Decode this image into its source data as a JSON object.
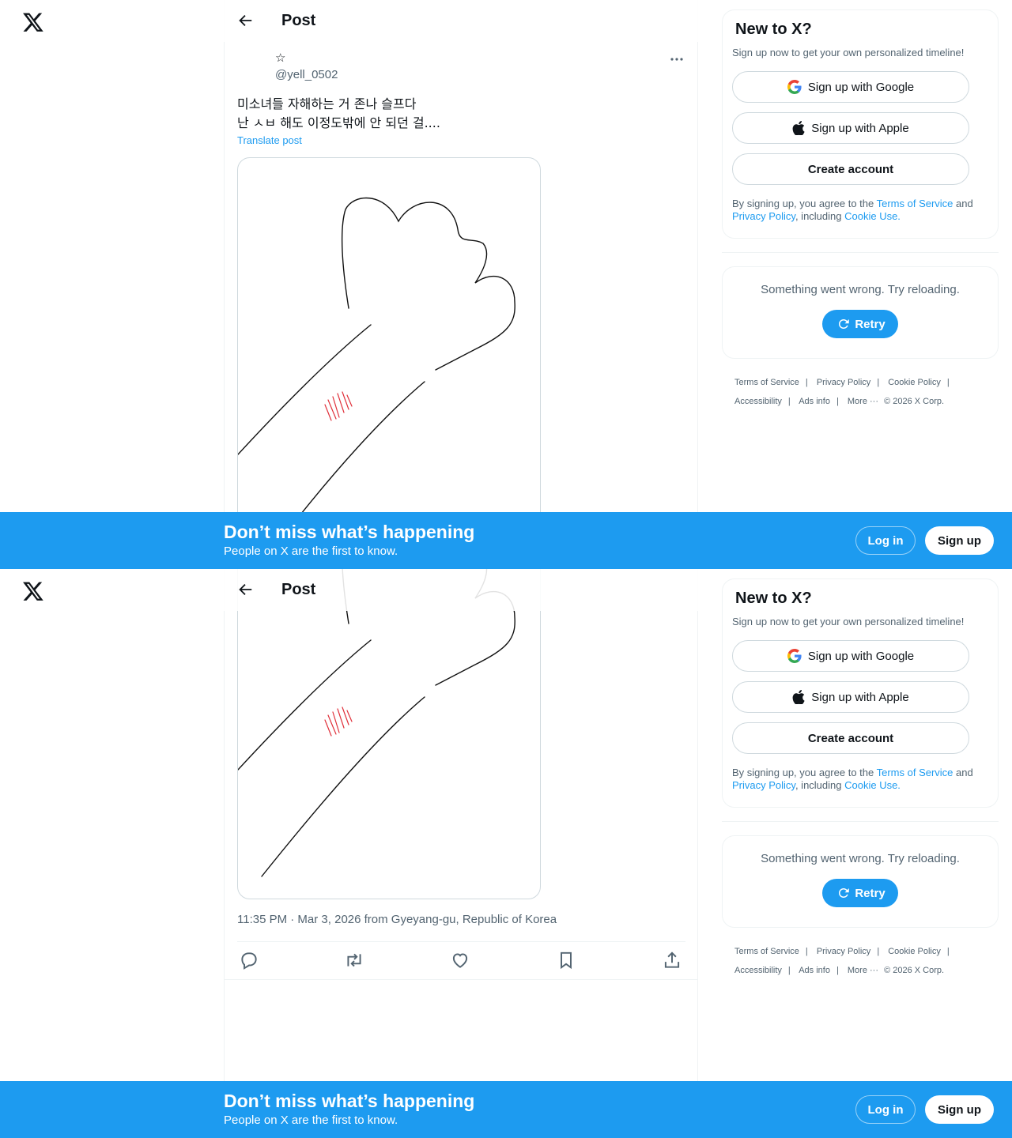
{
  "screens": [
    {
      "header": {
        "title": "Post"
      },
      "post": {
        "author_name": "☆",
        "handle": "@yell_0502",
        "text_line1": "미소녀들 자해하는 거 존나 슬프다",
        "text_line2": "난 ㅅㅂ 해도 이정도밖에 안 되던 걸....",
        "translate_label": "Translate post",
        "timestamp": "11:35 PM · Mar 3, 2026 from Gyeyang-gu, Republic of Korea"
      },
      "sidebar": {
        "heading": "New to X?",
        "subtext": "Sign up now to get your own personalized timeline!",
        "google_label": "Sign up with Google",
        "apple_label": "Sign up with Apple",
        "create_label": "Create account",
        "terms_prefix": "By signing up, you agree to the ",
        "terms_link": "Terms of Service",
        "terms_and": " and",
        "privacy_link": "Privacy Policy",
        "terms_including": ", including ",
        "cookie_link": "Cookie Use.",
        "error_msg": "Something went wrong. Try reloading.",
        "retry_label": "Retry",
        "footer": [
          "Terms of Service",
          "Privacy Policy",
          "Cookie Policy",
          "Accessibility",
          "Ads info",
          "More ···",
          "© 2026 X Corp."
        ]
      },
      "banner": {
        "headline": "Don’t miss what’s happening",
        "subline": "People on X are the first to know.",
        "login_label": "Log in",
        "signup_label": "Sign up"
      }
    },
    {
      "header": {
        "title": "Post"
      },
      "post": {
        "timestamp": "11:35 PM · Mar 3, 2026 from Gyeyang-gu, Republic of Korea"
      },
      "sidebar": {
        "heading": "New to X?",
        "subtext": "Sign up now to get your own personalized timeline!",
        "google_label": "Sign up with Google",
        "apple_label": "Sign up with Apple",
        "create_label": "Create account",
        "terms_prefix": "By signing up, you agree to the ",
        "terms_link": "Terms of Service",
        "terms_and": " and",
        "privacy_link": "Privacy Policy",
        "terms_including": ", including ",
        "cookie_link": "Cookie Use.",
        "error_msg": "Something went wrong. Try reloading.",
        "retry_label": "Retry",
        "footer": [
          "Terms of Service",
          "Privacy Policy",
          "Cookie Policy",
          "Accessibility",
          "Ads info",
          "More ···",
          "© 2026 X Corp."
        ]
      },
      "banner": {
        "headline": "Don’t miss what’s happening",
        "subline": "People on X are the first to know.",
        "login_label": "Log in",
        "signup_label": "Sign up"
      }
    }
  ],
  "colors": {
    "accent": "#1d9bf0",
    "text": "#0f1419",
    "muted": "#536471",
    "border": "#cfd9de",
    "mark": "#e0303a"
  }
}
